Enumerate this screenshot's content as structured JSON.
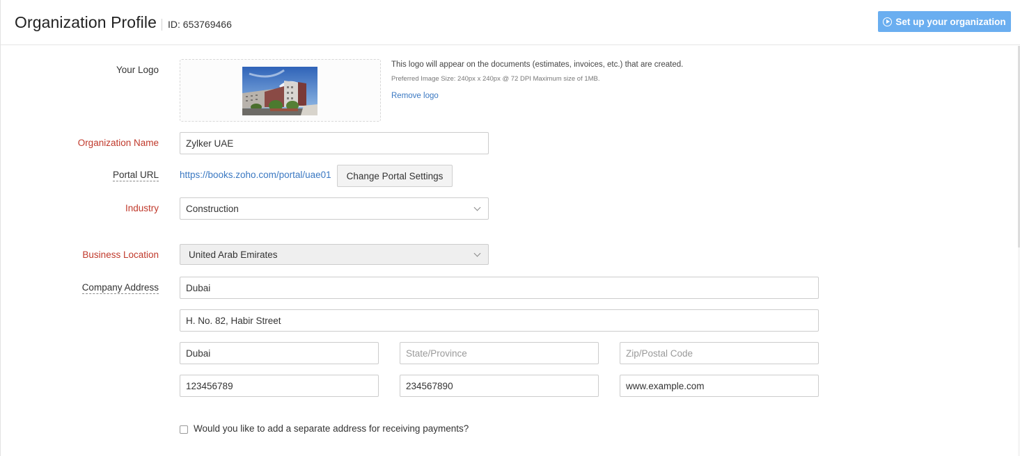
{
  "header": {
    "title": "Organization Profile",
    "org_id": "ID: 653769466",
    "setup_button": {
      "label": "Set up your organization",
      "icon": "play-circle-icon",
      "color": "#6aaef0"
    }
  },
  "form": {
    "logo": {
      "label": "Your Logo",
      "image_alt": "Organization logo (apartment buildings)",
      "note": "This logo will appear on the documents (estimates, invoices, etc.) that are created.",
      "size_hint": "Preferred Image Size: 240px x 240px @ 72 DPI Maximum size of 1MB.",
      "remove_label": "Remove logo"
    },
    "organization_name": {
      "label": "Organization Name",
      "value": "Zylker UAE",
      "required": true
    },
    "portal_url": {
      "label": "Portal URL",
      "value": "https://books.zoho.com/portal/uae01",
      "button_label": "Change Portal Settings"
    },
    "industry": {
      "label": "Industry",
      "selected": "Construction",
      "required": true
    },
    "business_location": {
      "label": "Business Location",
      "selected": "United Arab Emirates",
      "required": true,
      "disabled": true
    },
    "company_address": {
      "label": "Company Address",
      "street1": {
        "value": "Dubai",
        "placeholder": ""
      },
      "street2": {
        "value": "H. No. 82, Habir Street",
        "placeholder": ""
      },
      "city": {
        "value": "Dubai",
        "placeholder": ""
      },
      "state": {
        "value": "",
        "placeholder": "State/Province"
      },
      "zip": {
        "value": "",
        "placeholder": "Zip/Postal Code"
      },
      "phone": {
        "value": "123456789",
        "placeholder": ""
      },
      "fax": {
        "value": "234567890",
        "placeholder": ""
      },
      "website": {
        "value": "www.example.com",
        "placeholder": ""
      }
    },
    "payment_address_checkbox": {
      "label": "Would you like to add a separate address for receiving payments?",
      "checked": false
    }
  },
  "colors": {
    "required_label": "#c0392b",
    "link": "#3a78c2",
    "primary_button": "#6aaef0"
  }
}
